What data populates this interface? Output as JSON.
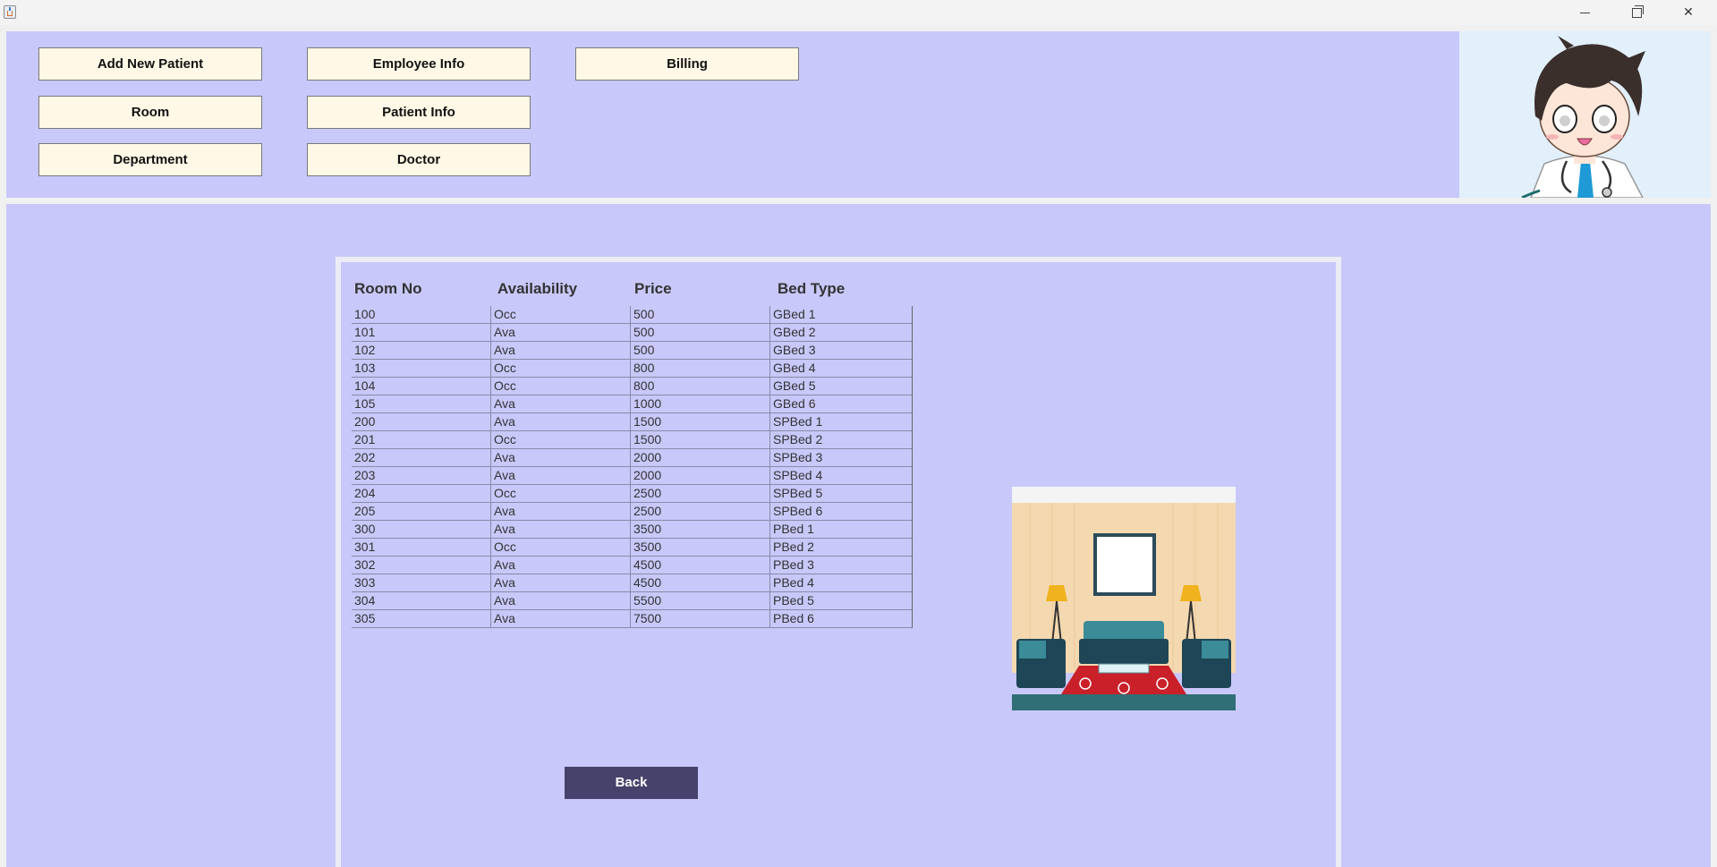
{
  "window": {
    "minimize_glyph": "",
    "maximize_glyph": "",
    "close_glyph": "✕"
  },
  "nav": {
    "add_new_patient": "Add New Patient",
    "employee_info": "Employee Info",
    "billing": "Billing",
    "room": "Room",
    "patient_info": "Patient Info",
    "department": "Department",
    "doctor": "Doctor"
  },
  "table": {
    "headers": [
      "Room No",
      "Availability",
      "Price",
      "Bed Type"
    ],
    "rows": [
      [
        "100",
        "Occ",
        "500",
        "GBed 1"
      ],
      [
        "101",
        "Ava",
        "500",
        "GBed 2"
      ],
      [
        "102",
        "Ava",
        "500",
        "GBed 3"
      ],
      [
        "103",
        "Occ",
        "800",
        "GBed 4"
      ],
      [
        "104",
        "Occ",
        "800",
        "GBed 5"
      ],
      [
        "105",
        "Ava",
        "1000",
        "GBed 6"
      ],
      [
        "200",
        "Ava",
        "1500",
        "SPBed 1"
      ],
      [
        "201",
        "Occ",
        "1500",
        "SPBed 2"
      ],
      [
        "202",
        "Ava",
        "2000",
        "SPBed 3"
      ],
      [
        "203",
        "Ava",
        "2000",
        "SPBed 4"
      ],
      [
        "204",
        "Occ",
        "2500",
        "SPBed 5"
      ],
      [
        "205",
        "Ava",
        "2500",
        "SPBed 6"
      ],
      [
        "300",
        "Ava",
        "3500",
        "PBed 1"
      ],
      [
        "301",
        "Occ",
        "3500",
        "PBed 2"
      ],
      [
        "302",
        "Ava",
        "4500",
        "PBed 3"
      ],
      [
        "303",
        "Ava",
        "4500",
        "PBed 4"
      ],
      [
        "304",
        "Ava",
        "5500",
        "PBed 5"
      ],
      [
        "305",
        "Ava",
        "7500",
        "PBed 6"
      ]
    ]
  },
  "back_label": "Back",
  "icons": {
    "app": "java-cup-icon",
    "avatar": "doctor-avatar",
    "room_picture": "living-room-illustration"
  },
  "colors": {
    "panel": "#c8c8fa",
    "nav_button": "#fff8e6",
    "back_button": "#47426b"
  }
}
